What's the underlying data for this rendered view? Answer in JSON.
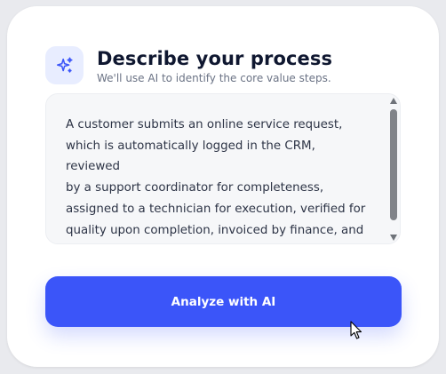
{
  "header": {
    "icon": "sparkles-icon",
    "title": "Describe your process",
    "subtitle": "We'll use AI to identify the core value steps."
  },
  "process_input": {
    "value": "A customer submits an online service request,\nwhich is automatically logged in the CRM, reviewed\nby a support coordinator for completeness,\nassigned to a technician for execution, verified for\nquality upon completion, invoiced by finance, and\nthen closed with a customer satisfaction survey."
  },
  "actions": {
    "analyze_label": "Analyze with AI"
  },
  "colors": {
    "accent": "#3b55f9",
    "icon_bg": "#e8edff",
    "title": "#0f1730"
  }
}
